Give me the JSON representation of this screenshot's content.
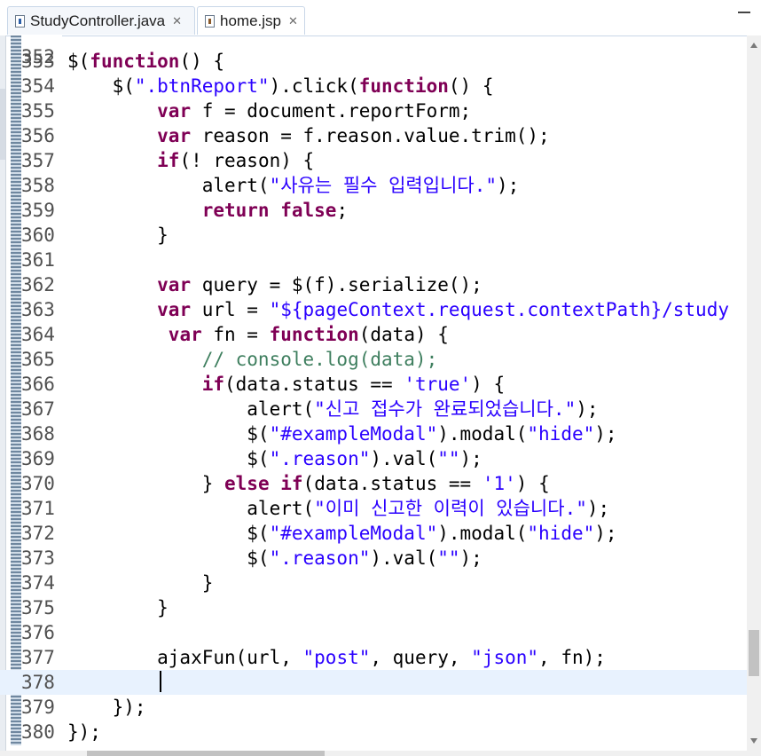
{
  "tabs": [
    {
      "label": "StudyController.java",
      "close": "✕",
      "icon": "java-file-icon"
    },
    {
      "label": "home.jsp",
      "close": "✕",
      "icon": "jsp-file-icon"
    }
  ],
  "editor": {
    "current_line": "378",
    "partial_line_number": "352",
    "lines": [
      {
        "n": "353",
        "t": [
          [
            "p",
            "$("
          ],
          [
            "k",
            "function"
          ],
          [
            "p",
            "() {"
          ]
        ]
      },
      {
        "n": "354",
        "t": [
          [
            "p",
            "    $("
          ],
          [
            "s",
            "\".btnReport\""
          ],
          [
            "p",
            ").click("
          ],
          [
            "k",
            "function"
          ],
          [
            "p",
            "() {"
          ]
        ]
      },
      {
        "n": "355",
        "t": [
          [
            "p",
            "        "
          ],
          [
            "k",
            "var"
          ],
          [
            "p",
            " f = document.reportForm;"
          ]
        ]
      },
      {
        "n": "356",
        "t": [
          [
            "p",
            "        "
          ],
          [
            "k",
            "var"
          ],
          [
            "p",
            " reason = f.reason.value.trim();"
          ]
        ]
      },
      {
        "n": "357",
        "t": [
          [
            "p",
            "        "
          ],
          [
            "k",
            "if"
          ],
          [
            "p",
            "(! reason) {"
          ]
        ]
      },
      {
        "n": "358",
        "t": [
          [
            "p",
            "            alert("
          ],
          [
            "s",
            "\"사유는 필수 입력입니다.\""
          ],
          [
            "p",
            ");"
          ]
        ]
      },
      {
        "n": "359",
        "t": [
          [
            "p",
            "            "
          ],
          [
            "k",
            "return"
          ],
          [
            "p",
            " "
          ],
          [
            "k",
            "false"
          ],
          [
            "p",
            ";"
          ]
        ]
      },
      {
        "n": "360",
        "t": [
          [
            "p",
            "        }"
          ]
        ]
      },
      {
        "n": "361",
        "t": [
          [
            "p",
            ""
          ]
        ]
      },
      {
        "n": "362",
        "t": [
          [
            "p",
            "        "
          ],
          [
            "k",
            "var"
          ],
          [
            "p",
            " query = $(f).serialize();"
          ]
        ]
      },
      {
        "n": "363",
        "t": [
          [
            "p",
            "        "
          ],
          [
            "k",
            "var"
          ],
          [
            "p",
            " url = "
          ],
          [
            "s",
            "\"${pageContext.request.contextPath}/study"
          ]
        ]
      },
      {
        "n": "364",
        "t": [
          [
            "p",
            "         "
          ],
          [
            "k",
            "var"
          ],
          [
            "p",
            " fn = "
          ],
          [
            "k",
            "function"
          ],
          [
            "p",
            "(data) {"
          ]
        ]
      },
      {
        "n": "365",
        "t": [
          [
            "p",
            "            "
          ],
          [
            "c",
            "// console.log(data);"
          ]
        ]
      },
      {
        "n": "366",
        "t": [
          [
            "p",
            "            "
          ],
          [
            "k",
            "if"
          ],
          [
            "p",
            "(data.status == "
          ],
          [
            "s",
            "'true'"
          ],
          [
            "p",
            ") {"
          ]
        ]
      },
      {
        "n": "367",
        "t": [
          [
            "p",
            "                alert("
          ],
          [
            "s",
            "\"신고 접수가 완료되었습니다.\""
          ],
          [
            "p",
            ");"
          ]
        ]
      },
      {
        "n": "368",
        "t": [
          [
            "p",
            "                $("
          ],
          [
            "s",
            "\"#exampleModal\""
          ],
          [
            "p",
            ").modal("
          ],
          [
            "s",
            "\"hide\""
          ],
          [
            "p",
            ");"
          ]
        ]
      },
      {
        "n": "369",
        "t": [
          [
            "p",
            "                $("
          ],
          [
            "s",
            "\".reason\""
          ],
          [
            "p",
            ").val("
          ],
          [
            "s",
            "\"\""
          ],
          [
            "p",
            ");"
          ]
        ]
      },
      {
        "n": "370",
        "t": [
          [
            "p",
            "            } "
          ],
          [
            "k",
            "else"
          ],
          [
            "p",
            " "
          ],
          [
            "k",
            "if"
          ],
          [
            "p",
            "(data.status == "
          ],
          [
            "s",
            "'1'"
          ],
          [
            "p",
            ") {"
          ]
        ]
      },
      {
        "n": "371",
        "t": [
          [
            "p",
            "                alert("
          ],
          [
            "s",
            "\"이미 신고한 이력이 있습니다.\""
          ],
          [
            "p",
            ");"
          ]
        ]
      },
      {
        "n": "372",
        "t": [
          [
            "p",
            "                $("
          ],
          [
            "s",
            "\"#exampleModal\""
          ],
          [
            "p",
            ").modal("
          ],
          [
            "s",
            "\"hide\""
          ],
          [
            "p",
            ");"
          ]
        ]
      },
      {
        "n": "373",
        "t": [
          [
            "p",
            "                $("
          ],
          [
            "s",
            "\".reason\""
          ],
          [
            "p",
            ").val("
          ],
          [
            "s",
            "\"\""
          ],
          [
            "p",
            ");"
          ]
        ]
      },
      {
        "n": "374",
        "t": [
          [
            "p",
            "            }"
          ]
        ]
      },
      {
        "n": "375",
        "t": [
          [
            "p",
            "        }"
          ]
        ]
      },
      {
        "n": "376",
        "t": [
          [
            "p",
            ""
          ]
        ]
      },
      {
        "n": "377",
        "t": [
          [
            "p",
            "        ajaxFun(url, "
          ],
          [
            "s",
            "\"post\""
          ],
          [
            "p",
            ", query, "
          ],
          [
            "s",
            "\"json\""
          ],
          [
            "p",
            ", fn);"
          ]
        ]
      },
      {
        "n": "378",
        "t": [
          [
            "p",
            ""
          ]
        ]
      },
      {
        "n": "379",
        "t": [
          [
            "p",
            "    });"
          ]
        ]
      },
      {
        "n": "380",
        "t": [
          [
            "p",
            "});"
          ]
        ]
      }
    ]
  },
  "colors": {
    "keyword": "#7f0055",
    "string": "#2a00ff",
    "comment": "#3f7f5f",
    "current_line_bg": "#e8f2fe"
  }
}
